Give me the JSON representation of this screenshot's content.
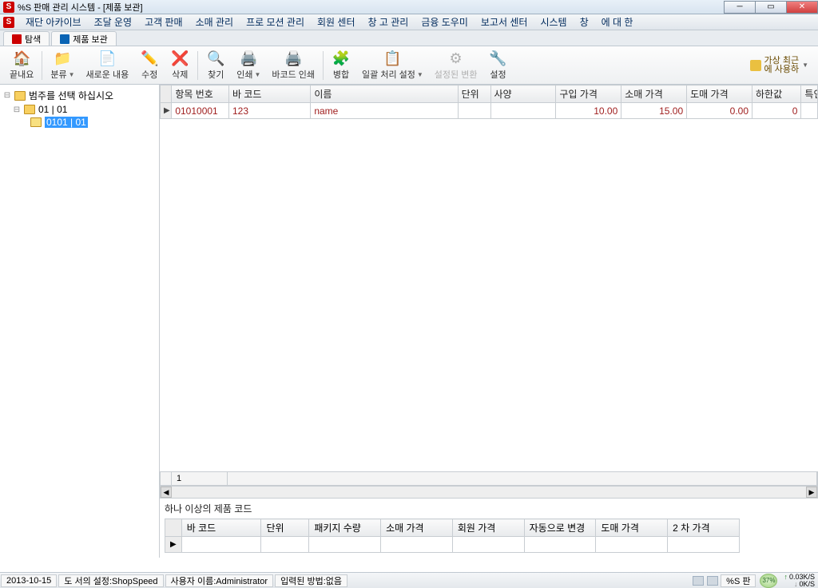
{
  "window": {
    "title": "%S 판매 관리 시스템 - [제품 보관]"
  },
  "menu": [
    "재단 아카이브",
    "조달 운영",
    "고객 판매",
    "소매 관리",
    "프로 모션 관리",
    "회원 센터",
    "창 고 관리",
    "금융 도우미",
    "보고서 센터",
    "시스템",
    "창",
    "에 대 한"
  ],
  "tabs": {
    "explore": "탐색",
    "product": "제품 보관"
  },
  "toolbar": {
    "close": "끝내요",
    "sort": "분류",
    "new": "새로운 내용",
    "edit": "수정",
    "delete": "삭제",
    "find": "찾기",
    "print": "인쇄",
    "barcode": "바코드 인쇄",
    "merge": "병합",
    "batch": "일괄 처리 설정",
    "change": "설정된 변환",
    "settings": "설정",
    "right1": "가상 최근",
    "right2": "에 사용하"
  },
  "tree": {
    "root": "범주를 선택 하십시오",
    "n1": "01 | 01",
    "n2": "0101 | 01"
  },
  "columns": {
    "item_no": "항목 번호",
    "barcode": "바 코드",
    "name": "이름",
    "unit": "단위",
    "spec": "사양",
    "purchase": "구입 가격",
    "retail": "소매 가격",
    "wholesale": "도매 가격",
    "lower": "하한값",
    "special": "특인"
  },
  "row": {
    "item_no": "01010001",
    "barcode": "123",
    "name": "name",
    "unit": "",
    "spec": "",
    "purchase": "10.00",
    "retail": "15.00",
    "wholesale": "0.00",
    "lower": "0"
  },
  "count": "1",
  "sub_label": "하나 이상의 제품 코드",
  "sub_columns": {
    "barcode": "바 코드",
    "unit": "단위",
    "pkg_qty": "패키지 수량",
    "retail": "소매 가격",
    "member": "회원 가격",
    "auto": "자동으로 변경",
    "wholesale": "도매 가격",
    "second": "2 차 가격"
  },
  "status": {
    "date": "2013-10-15",
    "docset": "도 서의 설정:ShopSpeed",
    "user": "사용자 이름:Administrator",
    "input": "입력된 방법:없음",
    "right_label": "%S 판",
    "pct": "37%",
    "up": "0.03K/S",
    "dn": "0K/S"
  }
}
